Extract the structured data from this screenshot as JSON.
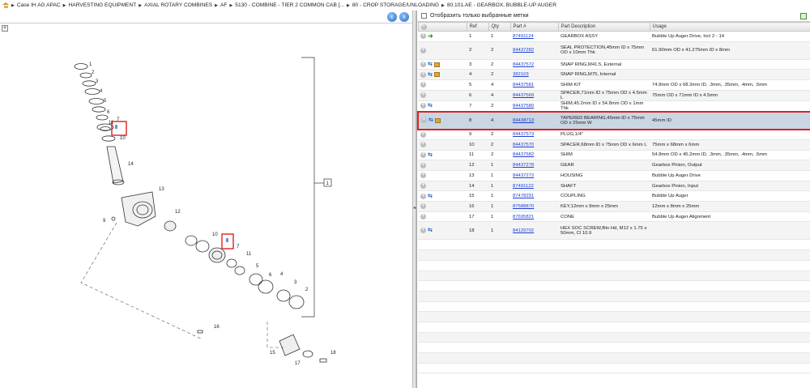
{
  "breadcrumb": [
    "Case IH AG APAC",
    "HARVESTING EQUIPMENT",
    "AXIAL ROTARY COMBINES",
    "AF",
    "5130 - COMBINE - TIER 2 COMMON CAB [...",
    "80 - CROP STORAGE/UNLOADING",
    "80.101.AE - GEARBOX, BUBBLE-UP AUGER"
  ],
  "nav": {
    "back": "‹",
    "forward": "›"
  },
  "filter": {
    "label": "Отобразить только выбранные метки"
  },
  "columns": [
    "",
    "Ref",
    "Qty",
    "Part #",
    "Part Description",
    "Usage"
  ],
  "parts": [
    {
      "ref": "1",
      "qty": "1",
      "part": "87491124",
      "desc": "GEARBOX ASSY",
      "usage": "Bubble Up Auger Drive, Incl 2 - 14",
      "icons": [
        "plus",
        "green"
      ]
    },
    {
      "ref": "2",
      "qty": "2",
      "part": "84437282",
      "desc": "SEAL PROTECTION,45mm ID x 75mm OD x 10mm Thk",
      "usage": "61.90mm OD x 41.275mm ID x 8mm",
      "icons": [
        "plus"
      ]
    },
    {
      "ref": "3",
      "qty": "2",
      "part": "84437572",
      "desc": "SNAP RING,M41.5, External",
      "usage": "",
      "icons": [
        "plus",
        "swap",
        "box"
      ]
    },
    {
      "ref": "4",
      "qty": "2",
      "part": "382103",
      "desc": "SNAP RING,M75, Internal",
      "usage": "",
      "icons": [
        "plus",
        "swap",
        "box"
      ]
    },
    {
      "ref": "5",
      "qty": "4",
      "part": "84437581",
      "desc": "SHIM KIT",
      "usage": "74.8mm OD x 68.3mm ID, .3mm, .35mm, .4mm, .5mm",
      "icons": [
        "plus"
      ]
    },
    {
      "ref": "6",
      "qty": "4",
      "part": "84437569",
      "desc": "SPACER,71mm ID x 75mm OD x 4.5mm L",
      "usage": "75mm OD x 71mm ID x 4.5mm",
      "icons": [
        "plus"
      ]
    },
    {
      "ref": "7",
      "qty": "2",
      "part": "84437580",
      "desc": "SHIM,45.2mm ID x 54.8mm OD x 1mm Thk",
      "usage": "",
      "icons": [
        "plus",
        "swap"
      ]
    },
    {
      "ref": "8",
      "qty": "4",
      "part": "84438713",
      "desc": "TAPERED BEARING,45mm ID x 75mm OD x 25mm W",
      "usage": "45mm ID",
      "icons": [
        "plus",
        "swap",
        "box"
      ],
      "selected": true
    },
    {
      "ref": "9",
      "qty": "2",
      "part": "84437573",
      "desc": "PLUG,1/4\"",
      "usage": "",
      "icons": [
        "plus"
      ]
    },
    {
      "ref": "10",
      "qty": "2",
      "part": "84437570",
      "desc": "SPACER,68mm ID x 75mm OD x 6mm L",
      "usage": "75mm x 68mm x 6mm",
      "icons": [
        "plus"
      ]
    },
    {
      "ref": "11",
      "qty": "2",
      "part": "84437582",
      "desc": "SHIM",
      "usage": "54.8mm OD x 45.2mm ID, .3mm, .35mm, .4mm, .5mm",
      "icons": [
        "plus",
        "swap"
      ]
    },
    {
      "ref": "12",
      "qty": "1",
      "part": "84437278",
      "desc": "GEAR",
      "usage": "Gearbox Pinion, Output",
      "icons": [
        "plus"
      ]
    },
    {
      "ref": "13",
      "qty": "1",
      "part": "84437272",
      "desc": "HOUSING",
      "usage": "Bubble Up Auger Drive",
      "icons": [
        "plus"
      ]
    },
    {
      "ref": "14",
      "qty": "1",
      "part": "87491122",
      "desc": "SHAFT",
      "usage": "Gearbox Pinion, Input",
      "icons": [
        "plus"
      ]
    },
    {
      "ref": "15",
      "qty": "1",
      "part": "87478291",
      "desc": "COUPLING",
      "usage": "Bubble Up Auger",
      "icons": [
        "plus",
        "swap"
      ]
    },
    {
      "ref": "16",
      "qty": "1",
      "part": "87588870",
      "desc": "KEY,12mm x 8mm x 25mm",
      "usage": "12mm x 8mm x 25mm",
      "icons": [
        "plus"
      ]
    },
    {
      "ref": "17",
      "qty": "1",
      "part": "87695821",
      "desc": "CONE",
      "usage": "Bubble Up Auger Alignment",
      "icons": [
        "plus"
      ]
    },
    {
      "ref": "18",
      "qty": "1",
      "part": "84129702",
      "desc": "HEX SOC SCREW,Btn Hd, M12 x 1.75 x 50mm, Cl 10.9",
      "usage": "",
      "icons": [
        "plus",
        "swap"
      ]
    }
  ],
  "diagram": {
    "callouts": [
      "1",
      "2",
      "3",
      "4",
      "5",
      "6",
      "11",
      "7",
      "10",
      "14",
      "13",
      "12",
      "9",
      "10",
      "7",
      "11",
      "5",
      "6",
      "4",
      "3",
      "2",
      "16",
      "15",
      "17",
      "18"
    ],
    "group_label": "1"
  },
  "colors": {
    "highlight": "#e02020",
    "selected_row": "#c9d6e3",
    "link": "#1a3fd6"
  }
}
